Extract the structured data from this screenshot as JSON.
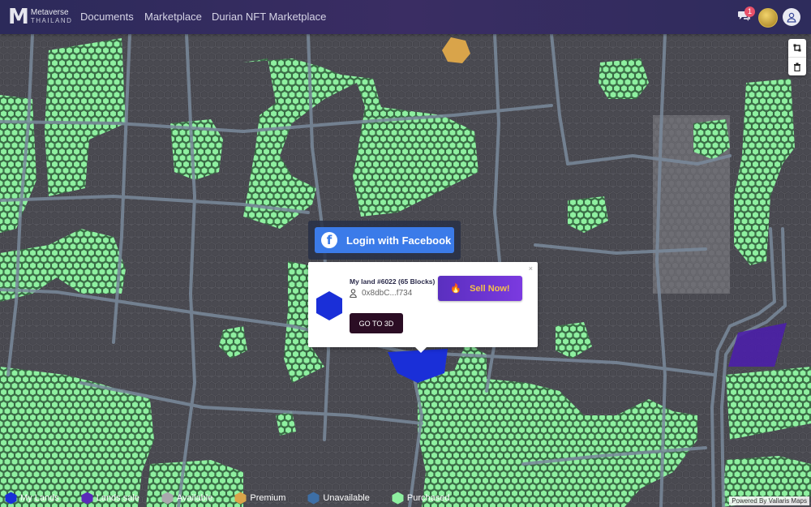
{
  "brand": {
    "name": "Metaverse",
    "sub": "THAILAND"
  },
  "nav": [
    {
      "label": "Documents"
    },
    {
      "label": "Marketplace"
    },
    {
      "label": "Durian NFT Marketplace"
    }
  ],
  "header": {
    "notification_count": "1",
    "chat_icon": "chat-bubbles-icon",
    "coin_icon": "gold-coin-icon",
    "user_icon": "user-icon"
  },
  "map_tools": {
    "draw_icon": "draw-polygon-icon",
    "trash_icon": "trash-icon"
  },
  "facebook": {
    "label": "Login with Facebook"
  },
  "popup": {
    "title": "My land #6022 (65 Blocks)",
    "owner": "0x8dbC...f734",
    "sell_label": "Sell Now!",
    "go3d_label": "GO TO 3D",
    "close_label": "×"
  },
  "legend": [
    {
      "label": "My Lands",
      "color": "#1a2fd8"
    },
    {
      "label": "Lands sale",
      "color": "#5a2ab8"
    },
    {
      "label": "Available",
      "color": "#a9a9ad"
    },
    {
      "label": "Premium",
      "color": "#d9a44a"
    },
    {
      "label": "Unavailable",
      "color": "#3d6fa6"
    },
    {
      "label": "Purchased",
      "color": "#8ef0a0"
    }
  ],
  "powered_by": "Powered By Vallaris Maps",
  "colors": {
    "purchased": "#8ef0a0",
    "available_dark": "#4e4e55",
    "my_land": "#1a2fd8",
    "for_sale": "#4b1fa8",
    "premium": "#d9a44a",
    "road": "#7a8a9c",
    "topbar": "#2e2b5e"
  }
}
